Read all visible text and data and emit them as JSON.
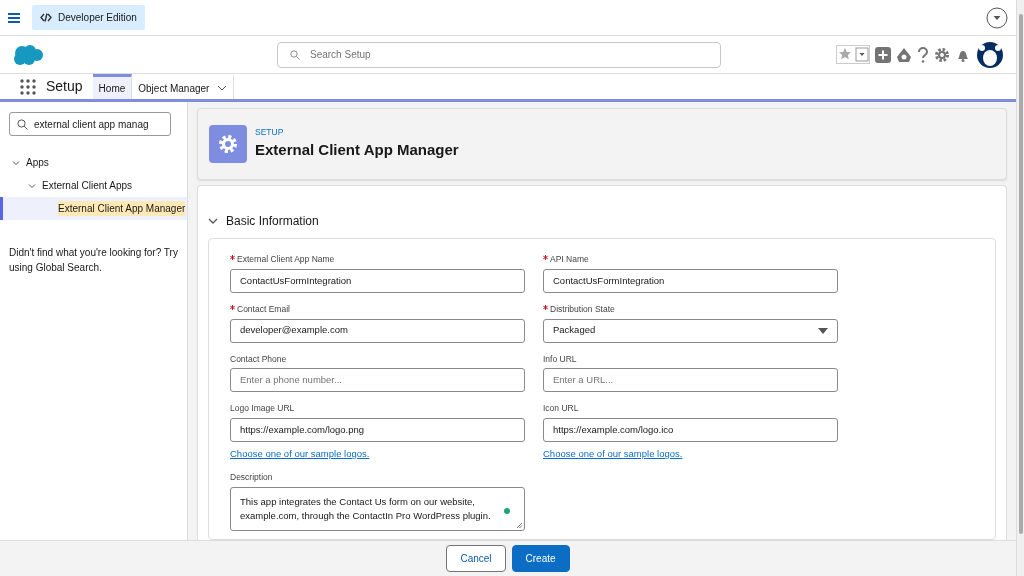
{
  "top_bar": {
    "edition": "Developer Edition"
  },
  "header": {
    "search": {
      "placeholder": "Search Setup"
    }
  },
  "nav": {
    "app_name": "Setup",
    "tabs": [
      {
        "label": "Home",
        "selected": true,
        "has_menu": false
      },
      {
        "label": "Object Manager",
        "selected": false,
        "has_menu": true
      }
    ]
  },
  "sidebar": {
    "search": {
      "value": "external client app manag"
    },
    "tree": [
      {
        "label": "Apps",
        "expanded": true,
        "selected": false,
        "children": [
          {
            "label": "External Client Apps",
            "expanded": true,
            "selected": false,
            "children": [
              {
                "label": "External Client App Manager",
                "selected": true
              }
            ]
          }
        ]
      }
    ],
    "help_text": "Didn't find what you're looking for? Try using Global Search."
  },
  "page_header": {
    "eyebrow": "SETUP",
    "title": "External Client App Manager"
  },
  "section": {
    "title": "Basic Information",
    "expanded": true,
    "fields": [
      {
        "kind": "text",
        "label": "External Client App Name",
        "required": true,
        "value": "ContactUsFormIntegration"
      },
      {
        "kind": "text",
        "label": "API Name",
        "required": true,
        "value": "ContactUsFormIntegration"
      },
      {
        "kind": "text",
        "label": "Contact Email",
        "required": true,
        "value": "developer@example.com"
      },
      {
        "kind": "select",
        "label": "Distribution State",
        "required": true,
        "value": "Packaged"
      },
      {
        "kind": "text",
        "label": "Contact Phone",
        "required": false,
        "placeholder": "Enter a phone number..."
      },
      {
        "kind": "text",
        "label": "Info URL",
        "required": false,
        "placeholder": "Enter a URL..."
      },
      {
        "kind": "text",
        "label": "Logo Image URL",
        "required": false,
        "value": "https://example.com/logo.png",
        "link": "Choose one of our sample logos."
      },
      {
        "kind": "text",
        "label": "Icon URL",
        "required": false,
        "value": "https://example.com/logo.ico",
        "link": "Choose one of our sample logos."
      },
      {
        "kind": "textarea",
        "label": "Description",
        "required": false,
        "value": "This app integrates the Contact Us form on our website, example.com, through the ContactIn Pro WordPress plugin."
      }
    ]
  },
  "footer": {
    "buttons": [
      {
        "label": "Cancel",
        "kind": "neutral"
      },
      {
        "label": "Create",
        "kind": "brand"
      }
    ]
  }
}
